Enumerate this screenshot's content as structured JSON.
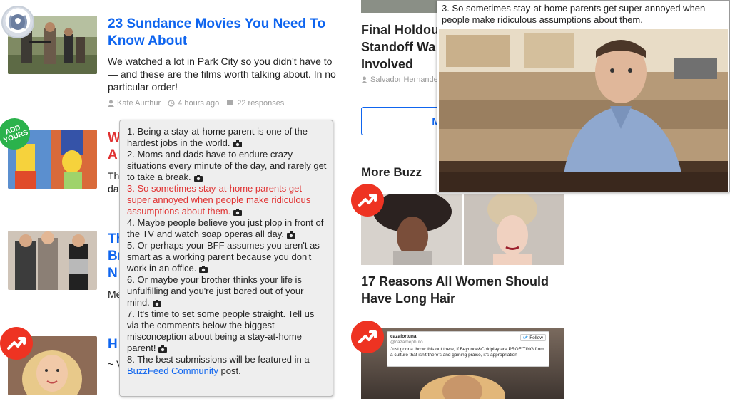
{
  "feed": [
    {
      "title": "23 Sundance Movies You Need To Know About",
      "description": "We watched a lot in Park City so you didn't have to — and these are the films worth talking about. In no particular order!",
      "author": "Kate Aurthur",
      "time": "4 hours ago",
      "responses": "22 responses"
    },
    {
      "title_partial": "W\nA",
      "description_partial": "Th\nda"
    },
    {
      "title_partial": "Th\nBr\nN",
      "description_partial": "Me"
    },
    {
      "title_partial": "H",
      "description_partial": "~ V"
    }
  ],
  "badges": {
    "add_yours": "ADD YOURS"
  },
  "popup_list": {
    "items": [
      "1. Being a stay-at-home parent is one of the hardest jobs in the world.",
      "2. Moms and dads have to endure crazy situations every minute of the day, and rarely get to take a break.",
      "3. So sometimes stay-at-home parents get super annoyed when people make ridiculous assumptions about them.",
      "4. Maybe people believe you just plop in front of the TV and watch soap operas all day.",
      "5. Or perhaps your BFF assumes you aren't as smart as a working parent because you don't work in an office.",
      "6. Or maybe your brother thinks your life is unfulfilling and you're just bored out of your mind.",
      "7. It's time to set some people straight. Tell us via the comments below the biggest misconception about being a stay-at-home parent!"
    ],
    "last_item_prefix": "8. The best submissions will be featured in a",
    "last_item_link": "BuzzFeed Community",
    "last_item_suffix": "post.",
    "active_index": 2,
    "active_color": "#e03131"
  },
  "right": {
    "headline_lines": [
      "Final Holdou",
      "Standoff Wa",
      "Involved"
    ],
    "author": "Salvador Hernande",
    "more_button": "M",
    "more_buzz_heading": "More Buzz",
    "story1_title": "17 Reasons All Women Should Have Long Hair",
    "tweet": {
      "user": "cazafortuna",
      "handle": "@cazamephuto",
      "follow": "Follow",
      "text": "Just gonna throw this out there, if Beyoncé&Coldplay are PROFITING from a culture that isn't there's and gaining praise, it's appropriation"
    }
  },
  "preview": {
    "caption": "3. So sometimes stay-at-home parents get super annoyed when people make ridiculous assumptions about them."
  },
  "colors": {
    "link_blue": "#0f65ef",
    "trending_red": "#ee3322",
    "add_green": "#2bb24c"
  }
}
